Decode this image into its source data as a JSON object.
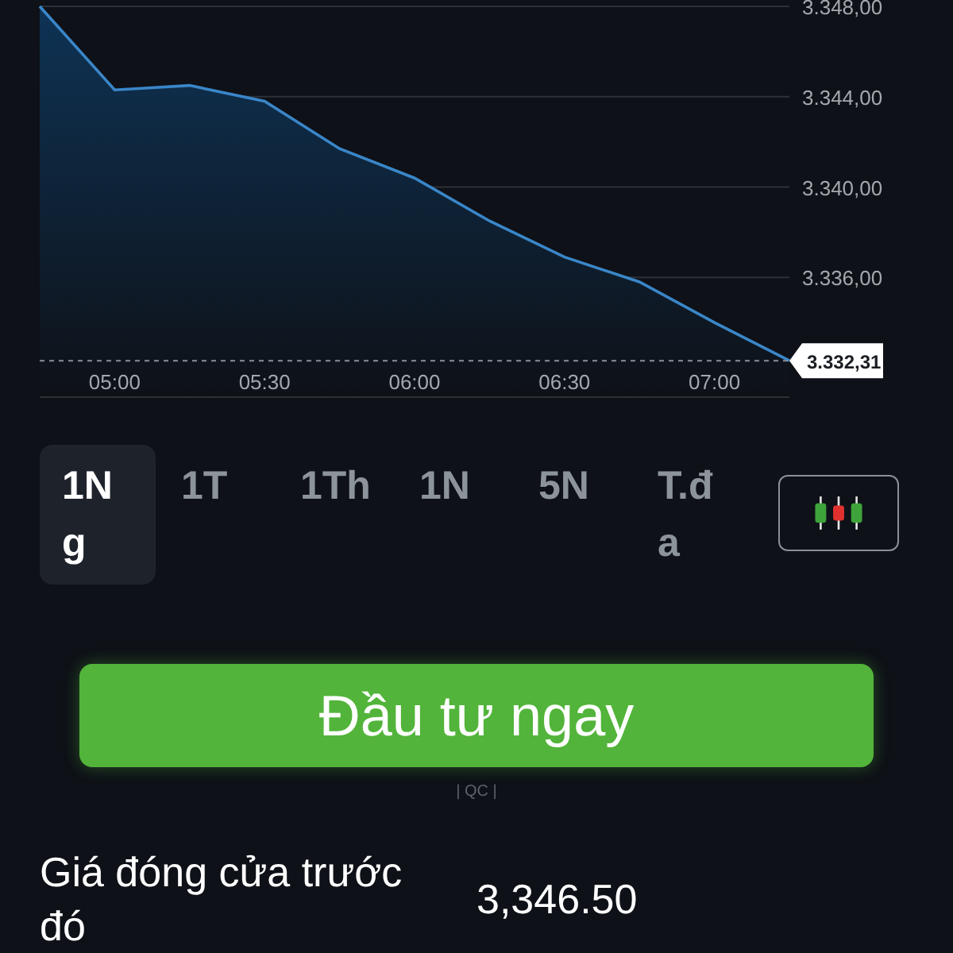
{
  "chart": {
    "chart_data": {
      "type": "area",
      "x": [
        285,
        300,
        315,
        330,
        345,
        360,
        375,
        390,
        405,
        420,
        435
      ],
      "series": [
        {
          "color": "#3a86c8",
          "values": [
            3348,
            3344.3,
            3344.5,
            3343.8,
            3341.7,
            3340.4,
            3338.5,
            3336.9,
            3335.8,
            3334.0,
            3332.31
          ]
        }
      ],
      "xticks": [
        {
          "value": 300,
          "label": "05:00"
        },
        {
          "value": 330,
          "label": "05:30"
        },
        {
          "value": 360,
          "label": "06:00"
        },
        {
          "value": 390,
          "label": "06:30"
        },
        {
          "value": 420,
          "label": "07:00"
        }
      ],
      "yticks": [
        {
          "value": 3348,
          "label": "3.348,00"
        },
        {
          "value": 3344,
          "label": "3.344,00"
        },
        {
          "value": 3340,
          "label": "3.340,00"
        },
        {
          "value": 3336,
          "label": "3.336,00"
        }
      ],
      "xlim": [
        285,
        435
      ],
      "ylim": [
        3330.7,
        3348
      ],
      "grid": true,
      "ref_lines": [
        {
          "axis": "y",
          "value": 3332.31,
          "label": "3.332,31"
        }
      ]
    }
  },
  "ranges": [
    {
      "label": "1Ng",
      "selected": true
    },
    {
      "label": "1T",
      "selected": false
    },
    {
      "label": "1Th",
      "selected": false
    },
    {
      "label": "1N",
      "selected": false
    },
    {
      "label": "5N",
      "selected": false
    },
    {
      "label": "T.đa",
      "selected": false
    }
  ],
  "invest_button": "Đầu tư ngay",
  "ad_label": "| QC |",
  "stats": [
    {
      "label": "Giá đóng cửa trước đó",
      "value": "3,346.50"
    }
  ]
}
